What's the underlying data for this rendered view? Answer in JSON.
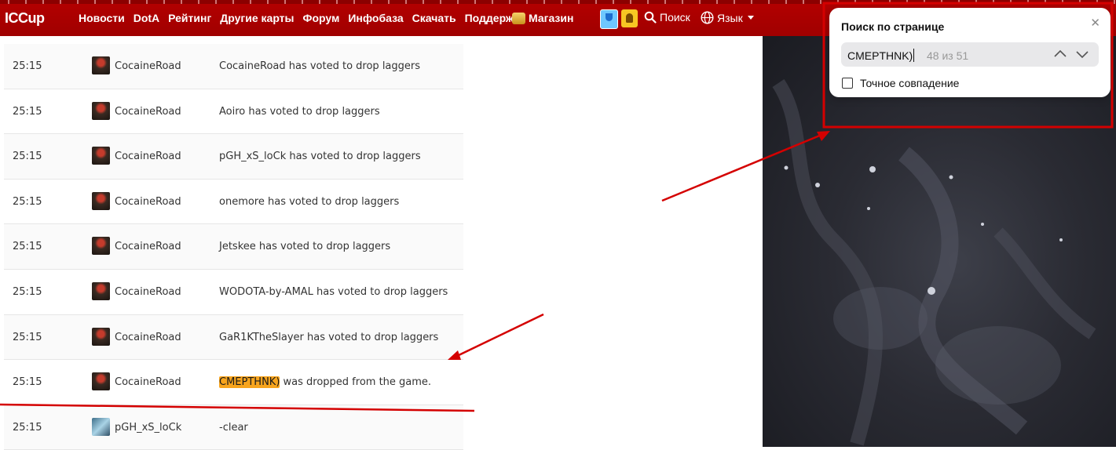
{
  "header": {
    "logo": "ICCup",
    "nav": [
      "Новости",
      "DotA",
      "Рейтинг",
      "Другие карты",
      "Форум",
      "Инфобаза",
      "Скачать",
      "Поддержка"
    ],
    "shop_label": "Магазин",
    "search_label": "Поиск",
    "language_label": "Язык"
  },
  "log": [
    {
      "time": "25:15",
      "player": "CocaineRoad",
      "message": "CocaineRoad has voted to drop laggers"
    },
    {
      "time": "25:15",
      "player": "CocaineRoad",
      "message": "Aoiro has voted to drop laggers"
    },
    {
      "time": "25:15",
      "player": "CocaineRoad",
      "message": "pGH_xS_loCk has voted to drop laggers"
    },
    {
      "time": "25:15",
      "player": "CocaineRoad",
      "message": "onemore has voted to drop laggers"
    },
    {
      "time": "25:15",
      "player": "CocaineRoad",
      "message": "Jetskee has voted to drop laggers"
    },
    {
      "time": "25:15",
      "player": "CocaineRoad",
      "message": "WODOTA-by-AMAL has voted to drop laggers"
    },
    {
      "time": "25:15",
      "player": "CocaineRoad",
      "message": "GaR1KTheSlayer has voted to drop laggers"
    },
    {
      "time": "25:15",
      "player": "CocaineRoad",
      "message_highlight": "CMEPTHNK)",
      "message_rest": " was dropped from the game."
    },
    {
      "time": "25:15",
      "player": "pGH_xS_loCk",
      "message": "-clear"
    }
  ],
  "find": {
    "title": "Поиск по странице",
    "query": "CMEPTHNK)",
    "count": "48 из 51",
    "exact_match_label": "Точное совпадение",
    "exact_match_checked": false
  },
  "colors": {
    "header_bg": "#b00000",
    "highlight": "#f7a41d",
    "annotation": "#d40000"
  },
  "icons": {
    "search": "search-icon",
    "globe": "globe-icon",
    "close": "close-icon",
    "up": "chevron-up-icon",
    "down": "chevron-down-icon"
  }
}
